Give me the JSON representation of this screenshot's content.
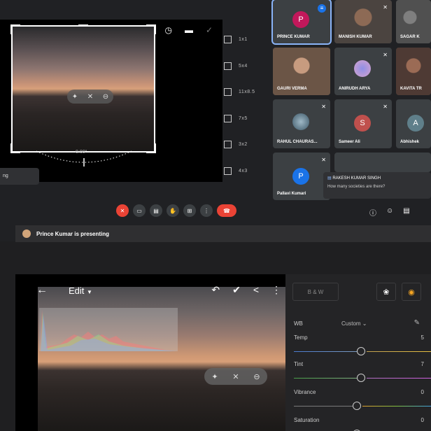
{
  "crop": {
    "aspect_ratios": [
      "1x1",
      "5x4",
      "11x8.5",
      "7x5",
      "3x2",
      "4x3"
    ],
    "rotation_label": "0.00°",
    "left_chip": "ng"
  },
  "participants": [
    {
      "name": "PRINCE KUMAR",
      "initial": "P",
      "avatar_color": "#c2185b",
      "active": true
    },
    {
      "name": "MANISH KUMAR",
      "initial": "",
      "avatar_color": "",
      "active": false
    },
    {
      "name": "SAGAR K",
      "initial": "",
      "avatar_color": "",
      "active": false
    },
    {
      "name": "GAURI VERMA",
      "initial": "",
      "avatar_color": "",
      "active": false
    },
    {
      "name": "ANIRUDH ARYA",
      "initial": "",
      "avatar_color": "",
      "active": false
    },
    {
      "name": "KAVITA TR",
      "initial": "",
      "avatar_color": "",
      "active": false
    },
    {
      "name": "RAHUL CHAURAS...",
      "initial": "",
      "avatar_color": "",
      "active": false
    },
    {
      "name": "Sameer Ali",
      "initial": "S",
      "avatar_color": "#c0504d",
      "active": false
    },
    {
      "name": "Abhishek",
      "initial": "A",
      "avatar_color": "#5f7f8a",
      "active": false
    },
    {
      "name": "Pallavi Kumari",
      "initial": "P",
      "avatar_color": "#1a73e8",
      "active": false
    }
  ],
  "chat_popup": {
    "sender": "RAKESH KUMAR SINGH",
    "message": "How many societies are there?"
  },
  "presenting": {
    "text": "Prince Kumar is presenting"
  },
  "editor": {
    "title": "Edit",
    "bw_label": "B & W",
    "wb_label": "WB",
    "wb_value": "Custom",
    "sliders": [
      {
        "label": "Temp",
        "value": "5",
        "level": 0.5
      },
      {
        "label": "Tint",
        "value": "7",
        "level": 0.5
      },
      {
        "label": "Vibrance",
        "value": "0",
        "level": 0.47
      },
      {
        "label": "Saturation",
        "value": "0",
        "level": 0.47
      }
    ]
  }
}
